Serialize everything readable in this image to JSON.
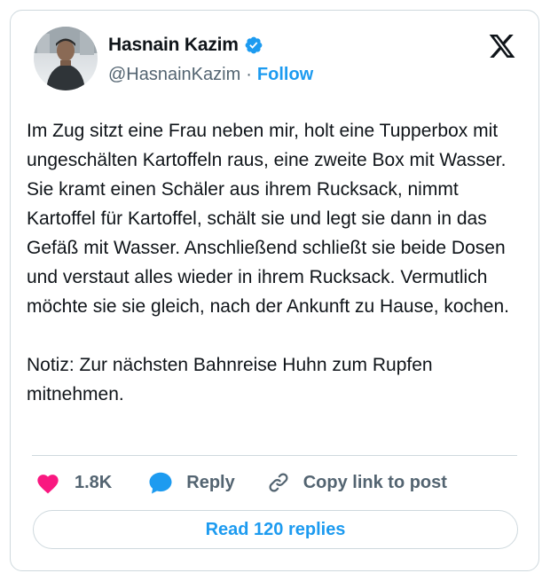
{
  "author": {
    "name": "Hasnain Kazim",
    "handle": "@HasnainKazim",
    "separator": "·",
    "follow_label": "Follow",
    "verified_icon": "verified-badge-icon",
    "verified_color": "#1d9bf0"
  },
  "brand_icon": "x-logo-icon",
  "tweet": {
    "text": "Im Zug sitzt eine Frau neben mir, holt eine Tupperbox mit ungeschälten Kartoffeln raus, eine zweite Box mit Wasser. Sie kramt einen Schäler aus ihrem Rucksack, nimmt Kartoffel für Kartoffel, schält sie und legt sie dann in das Gefäß mit Wasser. Anschließend schließt sie beide Dosen und verstaut alles wieder in ihrem Rucksack. Vermutlich möchte sie sie gleich, nach der Ankunft zu Hause, kochen.\n\nNotiz: Zur nächsten Bahnreise Huhn zum Rupfen mitnehmen."
  },
  "actions": {
    "like_icon": "heart-icon",
    "like_count": "1.8K",
    "like_color": "#f91880",
    "reply_icon": "speech-bubble-icon",
    "reply_label": "Reply",
    "reply_color": "#1d9bf0",
    "copy_icon": "link-icon",
    "copy_label": "Copy link to post"
  },
  "replies_button": {
    "label": "Read 120 replies"
  },
  "colors": {
    "accent": "#1d9bf0",
    "text": "#0f1419",
    "muted": "#536471",
    "border": "#cfd9de"
  }
}
